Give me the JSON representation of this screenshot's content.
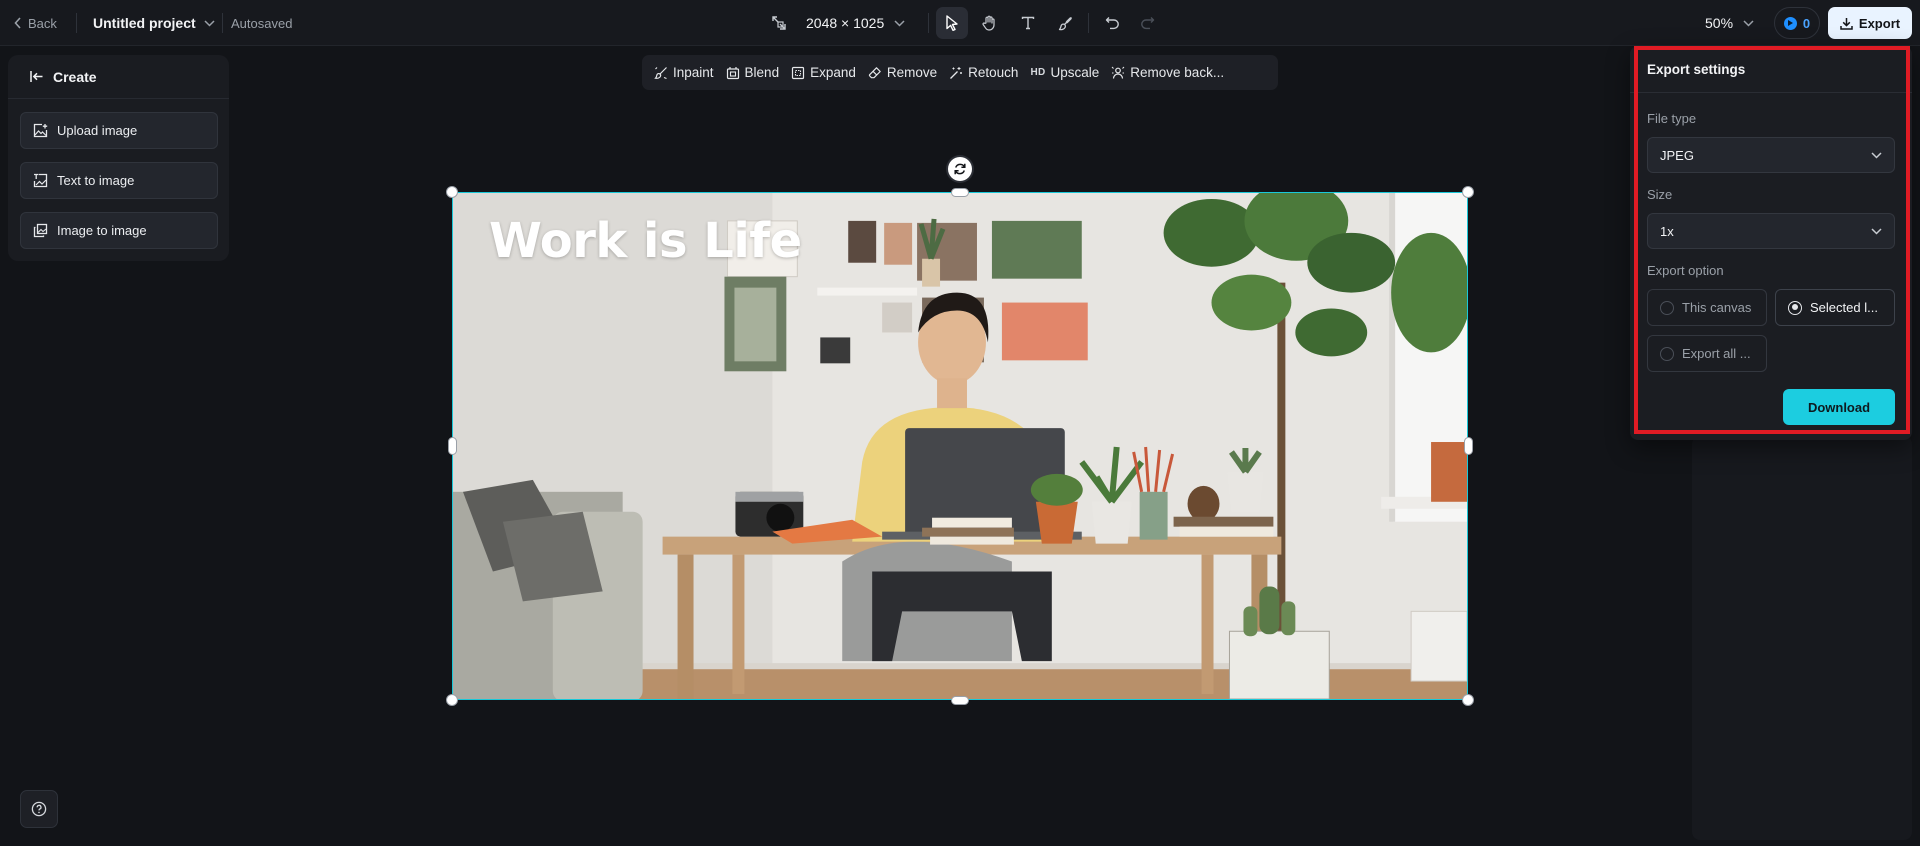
{
  "topbar": {
    "back_label": "Back",
    "project_title": "Untitled project",
    "autosave_status": "Autosaved",
    "canvas_size": "2048 × 1025",
    "zoom": "50%",
    "credits": "0",
    "export_label": "Export"
  },
  "left_panel": {
    "header": "Create",
    "items": [
      {
        "label": "Upload image",
        "icon": "upload-image-icon"
      },
      {
        "label": "Text to image",
        "icon": "text-to-image-icon"
      },
      {
        "label": "Image to image",
        "icon": "image-to-image-icon"
      }
    ]
  },
  "edit_toolbar": {
    "items": [
      {
        "label": "Inpaint",
        "icon": "inpaint-icon"
      },
      {
        "label": "Blend",
        "icon": "blend-icon"
      },
      {
        "label": "Expand",
        "icon": "expand-icon"
      },
      {
        "label": "Remove",
        "icon": "eraser-icon"
      },
      {
        "label": "Retouch",
        "icon": "retouch-icon"
      },
      {
        "label": "Upscale",
        "icon": "hd-icon",
        "icon_text": "HD"
      },
      {
        "label": "Remove back...",
        "icon": "remove-background-icon"
      }
    ]
  },
  "canvas": {
    "headline": "Work is Life"
  },
  "export_settings": {
    "title": "Export settings",
    "file_type_label": "File type",
    "file_type_value": "JPEG",
    "size_label": "Size",
    "size_value": "1x",
    "export_option_label": "Export option",
    "options": [
      {
        "label": "This canvas",
        "selected": false
      },
      {
        "label": "Selected l...",
        "selected": true
      },
      {
        "label": "Export all ...",
        "selected": false
      }
    ],
    "download_label": "Download"
  },
  "colors": {
    "accent_cyan": "#1ccde0",
    "selection_border": "#19c8d8",
    "highlight_red": "#e01b24",
    "background": "#121418"
  }
}
